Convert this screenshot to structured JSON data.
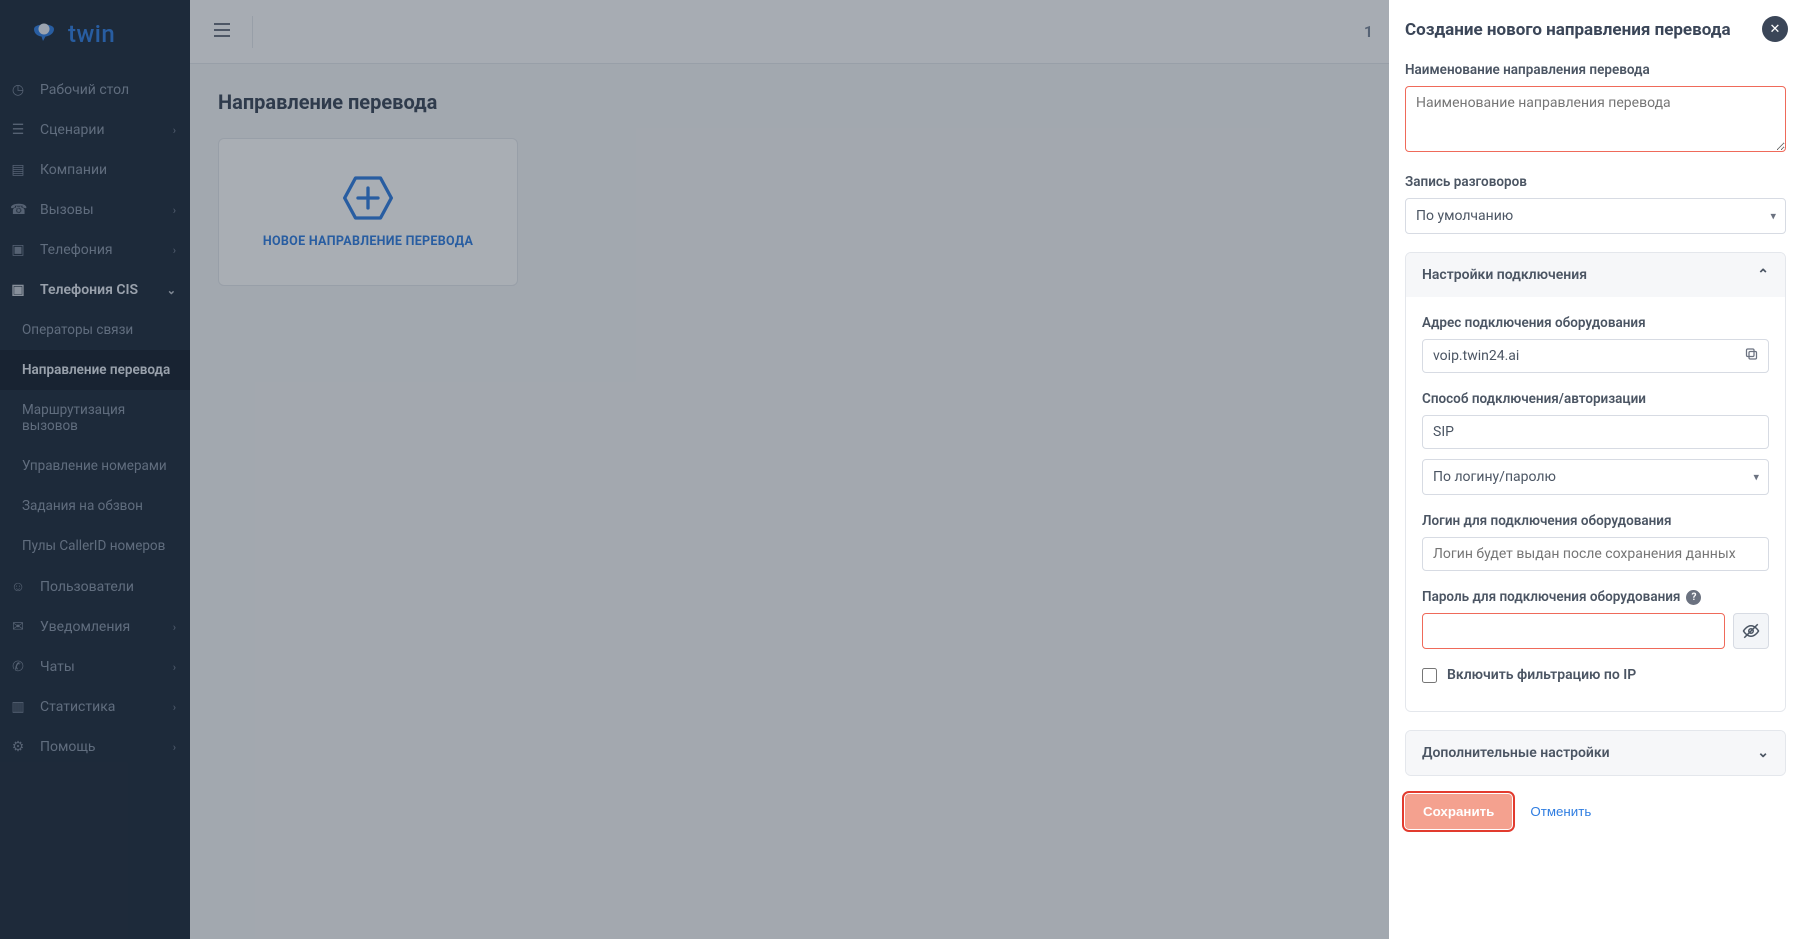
{
  "logo_text": "twin",
  "nav": {
    "desktop": "Рабочий стол",
    "scenarios": "Сценарии",
    "companies": "Компании",
    "calls": "Вызовы",
    "telephony": "Телефония",
    "telephony_cis": "Телефония CIS",
    "sub": {
      "operators": "Операторы связи",
      "transfer_direction": "Направление перевода",
      "call_routing": "Маршрутизация вызовов",
      "number_management": "Управление номерами",
      "dial_tasks": "Задания на обзвон",
      "callerid_pools": "Пулы CallerID номеров"
    },
    "users": "Пользователи",
    "notifications": "Уведомления",
    "chats": "Чаты",
    "statistics": "Статистика",
    "help": "Помощь"
  },
  "topbar": {
    "page_indicator": "1"
  },
  "page": {
    "title": "Направление перевода",
    "new_card_label": "НОВОЕ НАПРАВЛЕНИЕ ПЕРЕВОДА"
  },
  "drawer": {
    "title": "Создание нового направления перевода",
    "name_label": "Наименование направления перевода",
    "name_placeholder": "Наименование направления перевода",
    "recording_label": "Запись разговоров",
    "recording_value": "По умолчанию",
    "connection_settings": "Настройки подключения",
    "equip_address_label": "Адрес подключения оборудования",
    "equip_address_value": "voip.twin24.ai",
    "auth_method_label": "Способ подключения/авторизации",
    "auth_method_value": "SIP",
    "auth_mode_value": "По логину/паролю",
    "login_label": "Логин для подключения оборудования",
    "login_placeholder": "Логин будет выдан после сохранения данных",
    "password_label": "Пароль для подключения оборудования",
    "ip_filter_label": "Включить фильтрацию по IP",
    "additional_settings": "Дополнительные настройки",
    "save": "Сохранить",
    "cancel": "Отменить"
  }
}
